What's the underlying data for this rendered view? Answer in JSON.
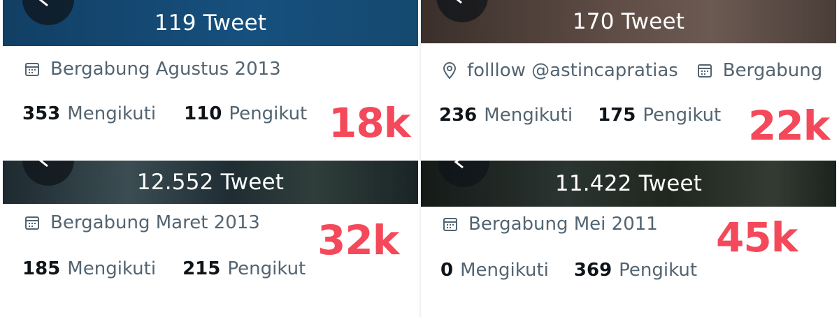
{
  "colors": {
    "follower_count_overlay": "#f4495a",
    "secondary_text": "#536471",
    "primary_text": "#0f1419"
  },
  "panels": [
    {
      "tweet_count": "119 Tweet",
      "location_text": "",
      "joined_text": "Bergabung Agustus 2013",
      "following_count": "353",
      "following_label": "Mengikuti",
      "followers_count": "110",
      "followers_label": "Pengikut",
      "overlay": "18k"
    },
    {
      "tweet_count": "170 Tweet",
      "location_text": "folllow @astincapratias",
      "joined_text": "Bergabung",
      "following_count": "236",
      "following_label": "Mengikuti",
      "followers_count": "175",
      "followers_label": "Pengikut",
      "overlay": "22k"
    },
    {
      "tweet_count": "12.552 Tweet",
      "location_text": "",
      "joined_text": "Bergabung Maret 2013",
      "following_count": "185",
      "following_label": "Mengikuti",
      "followers_count": "215",
      "followers_label": "Pengikut",
      "overlay": "32k"
    },
    {
      "tweet_count": "11.422 Tweet",
      "location_text": "",
      "joined_text": "Bergabung Mei 2011",
      "following_count": "0",
      "following_label": "Mengikuti",
      "followers_count": "369",
      "followers_label": "Pengikut",
      "overlay": "45k"
    }
  ]
}
